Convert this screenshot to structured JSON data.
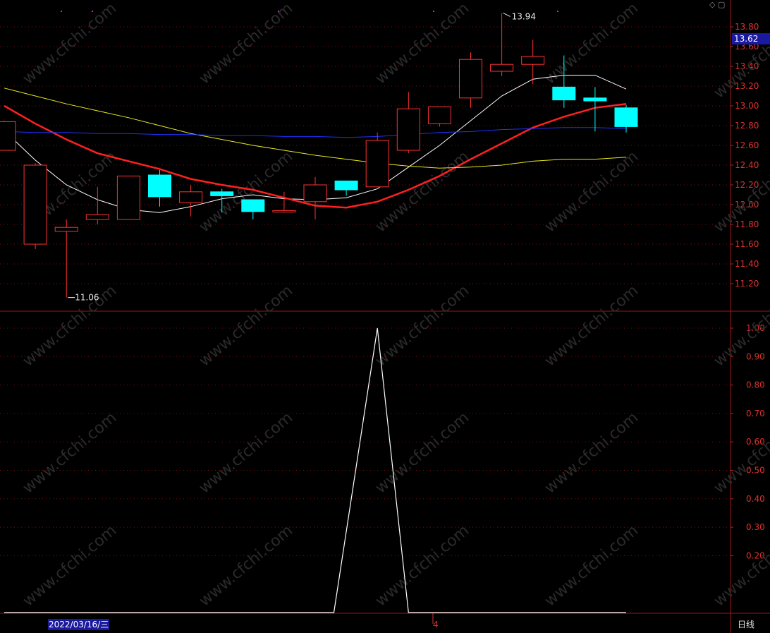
{
  "chart_data": [
    {
      "type": "candlestick",
      "panel": "price",
      "ylim": [
        11.0,
        14.1
      ],
      "yticks": [
        "13.80",
        "13.60",
        "13.40",
        "13.20",
        "13.00",
        "12.80",
        "12.60",
        "12.40",
        "12.20",
        "12.00",
        "11.80",
        "11.60",
        "11.40",
        "11.20"
      ],
      "candles": [
        {
          "o": 12.55,
          "h": 12.85,
          "l": 12.55,
          "c": 12.84
        },
        {
          "o": 11.6,
          "h": 12.42,
          "l": 11.55,
          "c": 12.4
        },
        {
          "o": 11.73,
          "h": 11.85,
          "l": 11.06,
          "c": 11.77
        },
        {
          "o": 11.85,
          "h": 12.18,
          "l": 11.8,
          "c": 11.9
        },
        {
          "o": 11.85,
          "h": 12.29,
          "l": 11.85,
          "c": 12.29
        },
        {
          "o": 12.3,
          "h": 12.35,
          "l": 11.98,
          "c": 12.08
        },
        {
          "o": 12.02,
          "h": 12.2,
          "l": 11.88,
          "c": 12.13
        },
        {
          "o": 12.13,
          "h": 12.16,
          "l": 11.92,
          "c": 12.09
        },
        {
          "o": 12.05,
          "h": 12.05,
          "l": 11.85,
          "c": 11.93
        },
        {
          "o": 11.93,
          "h": 12.13,
          "l": 11.92,
          "c": 11.94
        },
        {
          "o": 12.03,
          "h": 12.28,
          "l": 11.85,
          "c": 12.2
        },
        {
          "o": 12.24,
          "h": 12.24,
          "l": 12.09,
          "c": 12.15
        },
        {
          "o": 12.18,
          "h": 12.73,
          "l": 12.18,
          "c": 12.65
        },
        {
          "o": 12.55,
          "h": 13.14,
          "l": 12.52,
          "c": 12.97
        },
        {
          "o": 12.82,
          "h": 12.99,
          "l": 12.79,
          "c": 12.99
        },
        {
          "o": 13.08,
          "h": 13.54,
          "l": 12.98,
          "c": 13.47
        },
        {
          "o": 13.35,
          "h": 13.94,
          "l": 13.3,
          "c": 13.42
        },
        {
          "o": 13.42,
          "h": 13.67,
          "l": 13.22,
          "c": 13.5
        },
        {
          "o": 13.19,
          "h": 13.51,
          "l": 12.98,
          "c": 13.06
        },
        {
          "o": 13.08,
          "h": 13.19,
          "l": 12.74,
          "c": 13.05
        },
        {
          "o": 12.98,
          "h": 13.01,
          "l": 12.73,
          "c": 12.79
        }
      ],
      "high_label": "13.94",
      "low_label": "11.06",
      "last_price": "13.62",
      "ma_lines": [
        {
          "color": "#ffffff",
          "values": [
            12.75,
            12.45,
            12.2,
            12.05,
            11.95,
            11.92,
            11.98,
            12.06,
            12.1,
            12.06,
            12.05,
            12.07,
            12.16,
            12.38,
            12.6,
            12.85,
            13.1,
            13.27,
            13.31,
            13.31,
            13.17
          ]
        },
        {
          "color": "#ff2020",
          "values": [
            13.0,
            12.82,
            12.66,
            12.52,
            12.44,
            12.36,
            12.26,
            12.2,
            12.15,
            12.07,
            11.99,
            11.97,
            12.03,
            12.15,
            12.29,
            12.46,
            12.62,
            12.78,
            12.89,
            12.98,
            13.02
          ]
        },
        {
          "color": "#e8e820",
          "values": [
            13.18,
            13.1,
            13.02,
            12.95,
            12.88,
            12.8,
            12.72,
            12.66,
            12.6,
            12.55,
            12.5,
            12.46,
            12.42,
            12.39,
            12.37,
            12.38,
            12.4,
            12.44,
            12.46,
            12.46,
            12.48
          ]
        },
        {
          "color": "#2030ff",
          "values": [
            12.74,
            12.73,
            12.73,
            12.72,
            12.72,
            12.71,
            12.71,
            12.7,
            12.7,
            12.69,
            12.69,
            12.68,
            12.69,
            12.71,
            12.73,
            12.74,
            12.76,
            12.77,
            12.78,
            12.78,
            12.77
          ]
        }
      ]
    },
    {
      "type": "line",
      "panel": "indicator",
      "ylim": [
        0.0,
        1.05
      ],
      "yticks": [
        "1.00",
        "0.90",
        "0.80",
        "0.70",
        "0.60",
        "0.50",
        "0.40",
        "0.30",
        "0.20"
      ],
      "values": [
        0,
        0,
        0,
        0,
        0,
        0,
        0,
        0,
        0,
        0,
        0,
        0,
        0,
        0,
        0,
        0,
        0,
        0,
        0,
        0,
        0
      ],
      "x_points": [
        0,
        1,
        2,
        3,
        4,
        5,
        6,
        7,
        8,
        9,
        10,
        10.6,
        12,
        13.0,
        14,
        15,
        16,
        17,
        18,
        19,
        20
      ],
      "line_values": [
        0,
        0,
        0,
        0,
        0,
        0,
        0,
        0,
        0,
        0,
        0,
        0,
        1,
        0,
        0,
        0,
        0,
        0,
        0,
        0,
        0
      ]
    }
  ],
  "footer": {
    "date_label": "2022/03/16/三",
    "month_label": "4",
    "period_label": "日线"
  },
  "watermark": "www.cfchi.com"
}
